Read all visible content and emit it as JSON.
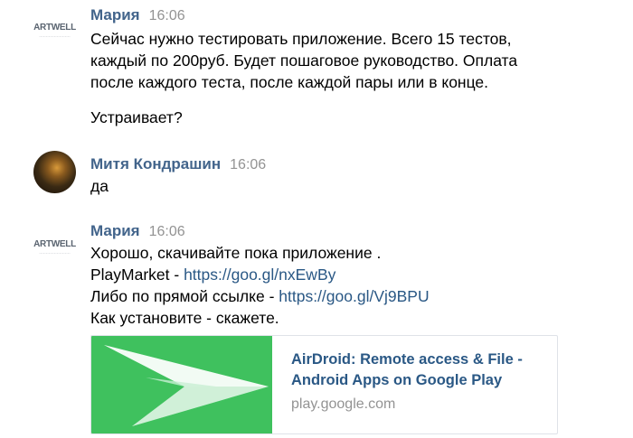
{
  "messages": [
    {
      "author": "Мария",
      "time": "16:06",
      "avatar_logo_text": "ARTWELL",
      "lines": [
        "Сейчас нужно тестировать приложение. Всего 15 тестов,",
        "каждый по 200руб. Будет пошаговое руководство. Оплата",
        "после каждого теста, после каждой пары или в конце.",
        "Устраивает?"
      ]
    },
    {
      "author": "Митя Кондрашин",
      "time": "16:06",
      "lines": [
        "да"
      ]
    },
    {
      "author": "Мария",
      "time": "16:06",
      "avatar_logo_text": "ARTWELL",
      "lines": [
        "Хорошо, скачивайте пока приложение .",
        "PlayMarket - ",
        "Либо по прямой ссылке - ",
        "Как установите - скажете."
      ],
      "links": [
        "https://goo.gl/nxEwBy",
        "https://goo.gl/Vj9BPU"
      ]
    }
  ],
  "link_card": {
    "title_line1": "AirDroid: Remote access & File -",
    "title_line2": "Android Apps on Google Play",
    "domain": "play.google.com",
    "image_color": "#3fc15e"
  },
  "colors": {
    "author": "#42648b",
    "link": "#2a5885",
    "time": "#939393"
  }
}
